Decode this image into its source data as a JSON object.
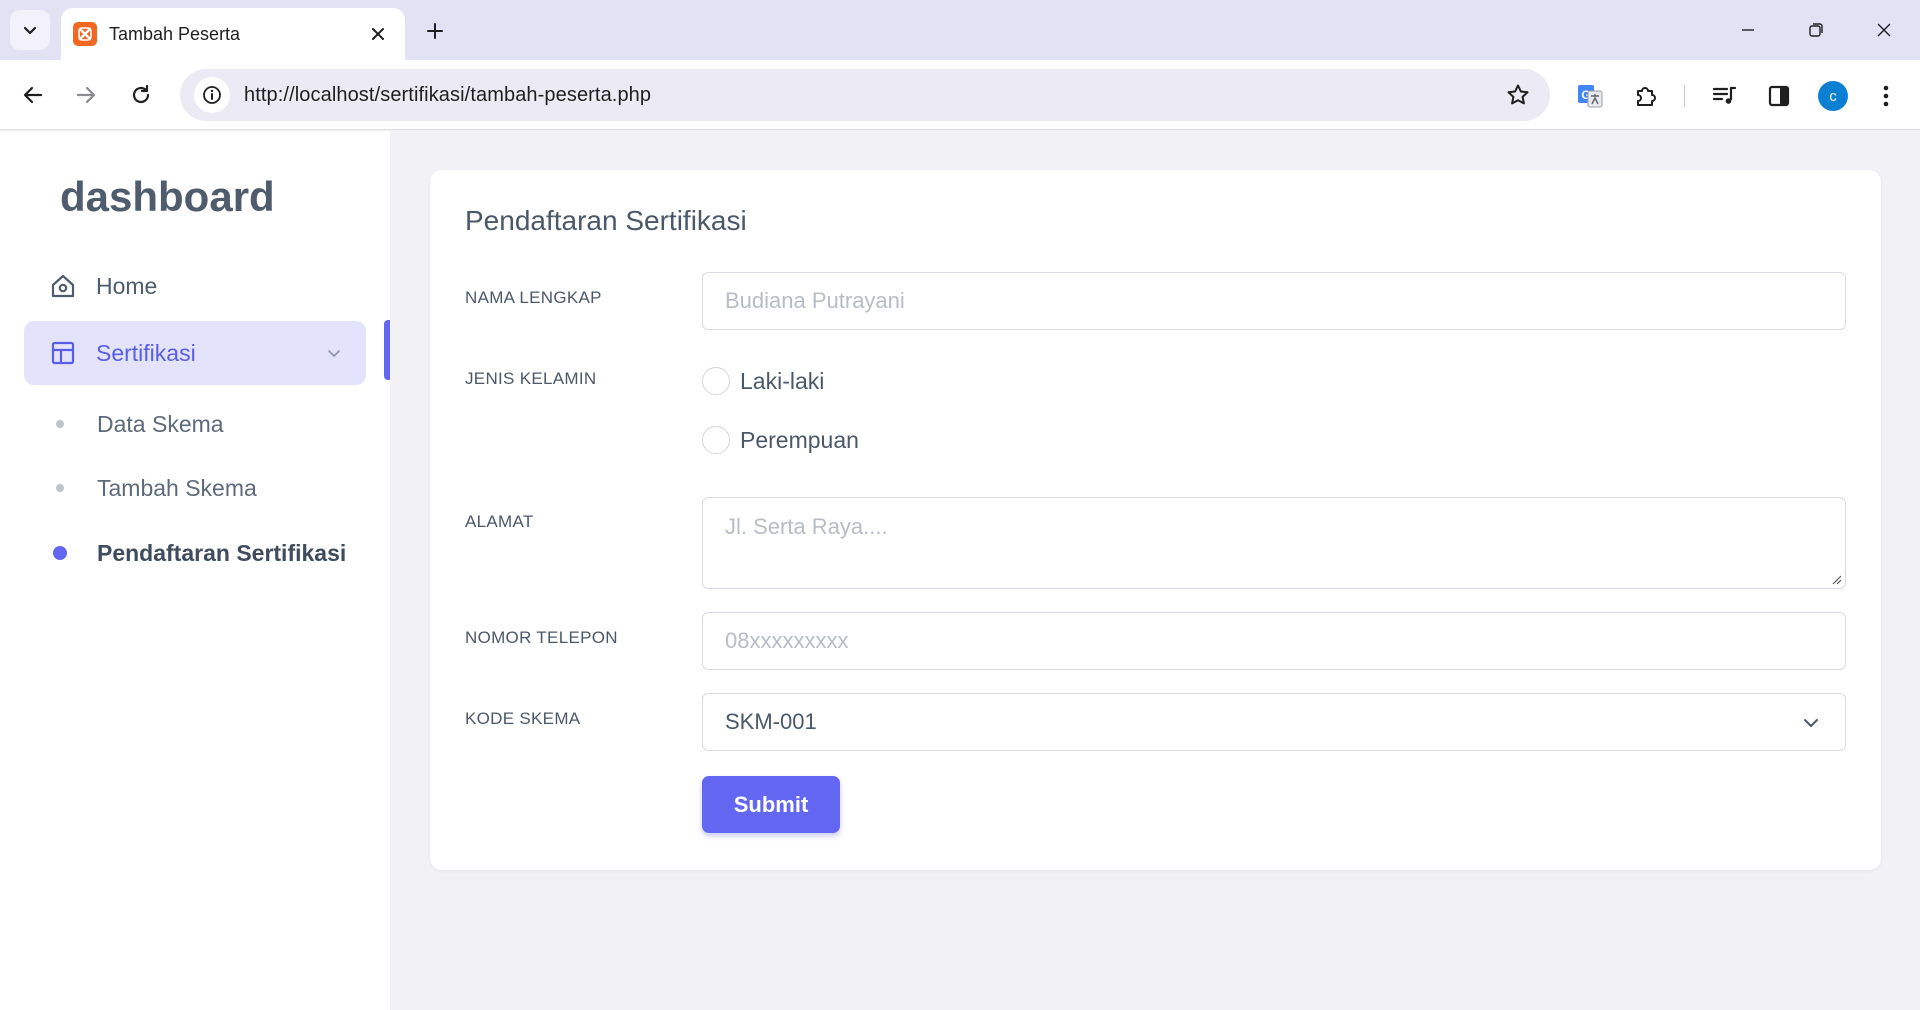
{
  "browser": {
    "tab_title": "Tambah Peserta",
    "url": "http://localhost/sertifikasi/tambah-peserta.php",
    "profile_initial": "c"
  },
  "colors": {
    "accent": "#6366f1",
    "favicon": "#f26722",
    "profile": "#0b7fd1"
  },
  "sidebar": {
    "brand": "dashboard",
    "home_label": "Home",
    "menu_label": "Sertifikasi",
    "submenu": [
      {
        "label": "Data Skema",
        "active": false
      },
      {
        "label": "Tambah Skema",
        "active": false
      },
      {
        "label": "Pendaftaran Sertifikasi",
        "active": true
      }
    ]
  },
  "form": {
    "title": "Pendaftaran Sertifikasi",
    "nama": {
      "label": "NAMA LENGKAP",
      "placeholder": "Budiana Putrayani"
    },
    "jenis_kelamin": {
      "label": "JENIS KELAMIN",
      "options": [
        "Laki-laki",
        "Perempuan"
      ]
    },
    "alamat": {
      "label": "ALAMAT",
      "placeholder": "Jl. Serta Raya...."
    },
    "telepon": {
      "label": "NOMOR TELEPON",
      "placeholder": "08xxxxxxxxx"
    },
    "kode_skema": {
      "label": "KODE SKEMA",
      "value": "SKM-001"
    },
    "submit_label": "Submit"
  }
}
